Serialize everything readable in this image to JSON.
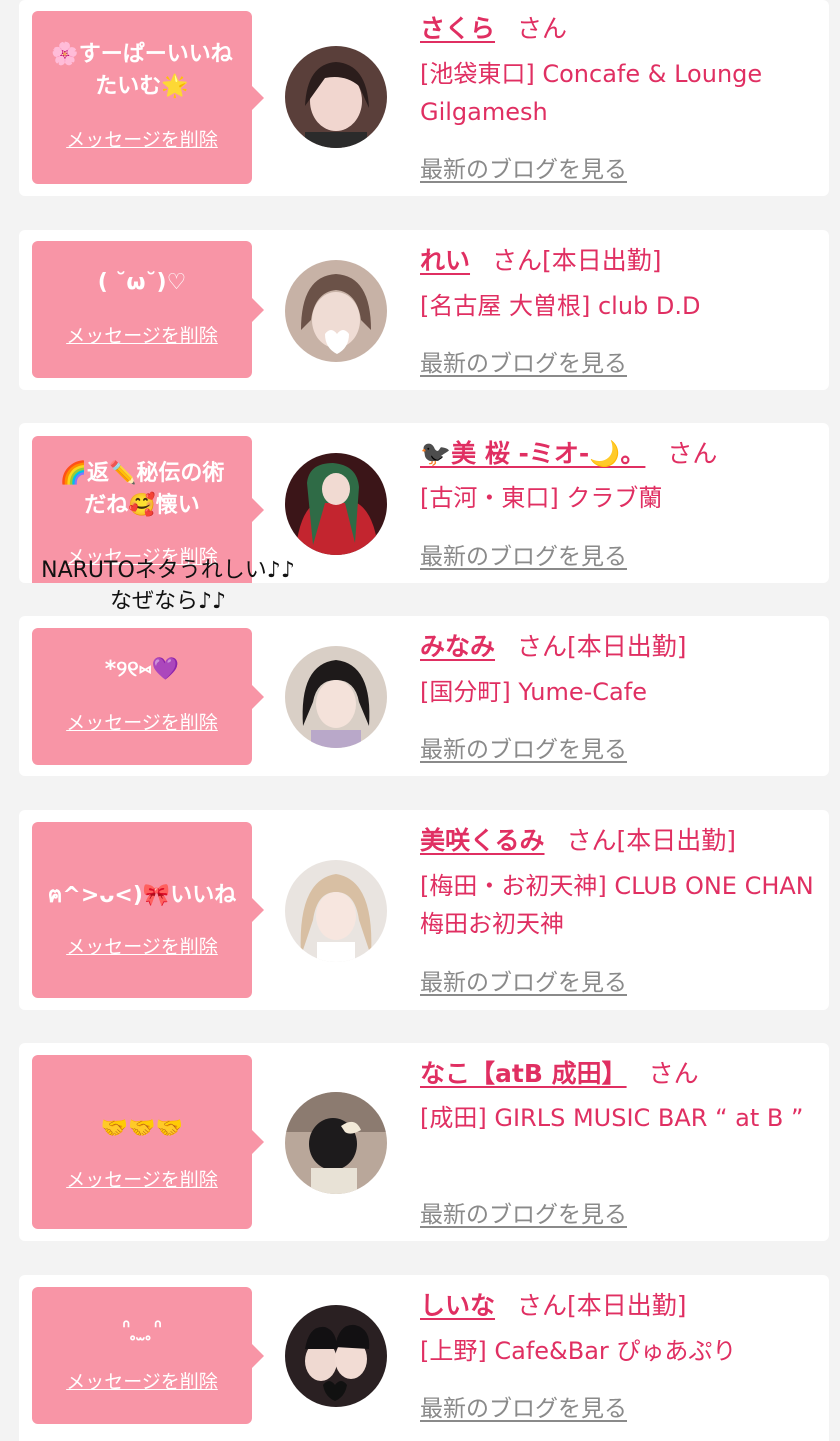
{
  "delete_label": "メッセージを削除",
  "blog_label": "最新のブログを見る",
  "san_label": "さん",
  "overlay_text": [
    "NARUTOネタうれしい♪♪",
    "なぜなら♪♪"
  ],
  "colors": {
    "background": "#f3f3f3",
    "card": "#ffffff",
    "bubble": "#f895a6",
    "accent": "#e02f62",
    "link_gray": "#8a8a8a"
  },
  "entries": [
    {
      "message_lines": [
        "🌸すーぱーいいね",
        "たいむ🌟"
      ],
      "name": "さくら",
      "shift": "",
      "store": "[池袋東口] Concafe & Lounge Gilgamesh"
    },
    {
      "message_lines": [
        "( ˘ω˘)♡"
      ],
      "name": "れい",
      "shift": "[本日出勤]",
      "store": "[名古屋 大曽根] club D.D"
    },
    {
      "message_lines": [
        "🌈返✏️秘伝の術",
        "だね🥰懐い"
      ],
      "name": "🐦‍⬛美 桜 -ミオ-🌙。",
      "shift": "",
      "store": "[古河・東口] クラブ蘭"
    },
    {
      "message_lines": [
        "*୨୧⑅💜"
      ],
      "name": "みなみ",
      "shift": "[本日出勤]",
      "store": "[国分町] Yume-Cafe"
    },
    {
      "message_lines": [
        "ฅ^>ᴗ<)🎀いいね"
      ],
      "name": "美咲くるみ",
      "shift": "[本日出勤]",
      "store": "[梅田・お初天神] CLUB ONE CHAN 梅田お初天神"
    },
    {
      "message_lines": [
        "🤝🤝🤝"
      ],
      "name": "なこ【atB 成田】",
      "shift": "",
      "store": "[成田] GIRLS MUSIC BAR “ at B ”"
    },
    {
      "message_lines": [
        "ᐢ ̥ ̫ ̥ᐢ"
      ],
      "name": "しいな",
      "shift": "[本日出勤]",
      "store": "[上野] Cafe&Bar ぴゅあぷり"
    }
  ]
}
